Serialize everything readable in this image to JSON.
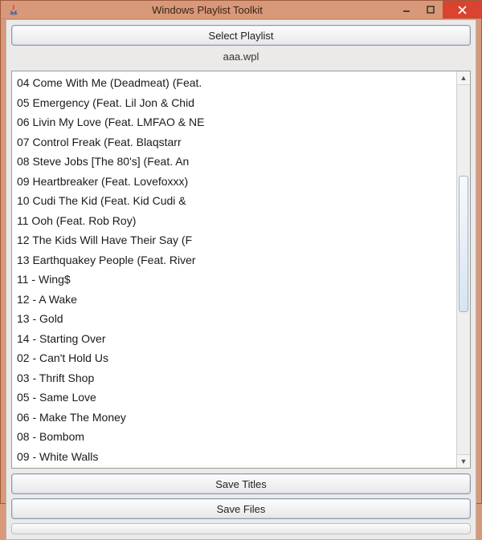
{
  "window": {
    "title": "Windows Playlist Toolkit"
  },
  "buttons": {
    "select_playlist": "Select Playlist",
    "save_titles": "Save Titles",
    "save_files": "Save Files"
  },
  "playlist": {
    "filename": "aaa.wpl",
    "items": [
      "04 Come With Me (Deadmeat) (Feat.",
      "05 Emergency (Feat. Lil Jon & Chid",
      "06 Livin My Love (Feat. LMFAO & NE",
      "07 Control Freak (Feat. Blaqstarr",
      "08 Steve Jobs [The 80's] (Feat. An",
      "09 Heartbreaker (Feat. Lovefoxxx)",
      "10 Cudi The Kid (Feat. Kid Cudi &",
      "11 Ooh (Feat. Rob Roy)",
      "12 The Kids Will Have Their Say (F",
      "13 Earthquakey People (Feat. River",
      "11 - Wing$",
      "12 - A Wake",
      "13 - Gold",
      "14 - Starting Over",
      "02 - Can't Hold Us",
      "03 - Thrift Shop",
      "05 - Same Love",
      "06 - Make The Money",
      "08 - Bombom",
      "09 - White Walls"
    ]
  }
}
